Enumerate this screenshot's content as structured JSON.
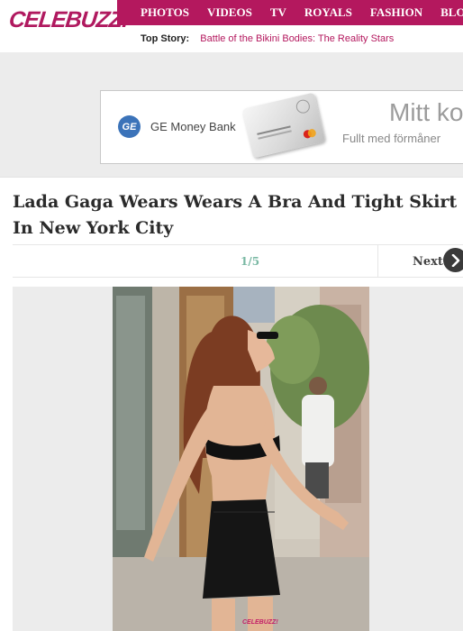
{
  "logo": "CELEBUZZ!",
  "nav": [
    "Photos",
    "Videos",
    "TV",
    "Royals",
    "Fashion",
    "Blogger"
  ],
  "top_story": {
    "label": "Top Story:",
    "link": "Battle of the Bikini Bodies: The Reality Stars"
  },
  "ad": {
    "brand_icon": "GE",
    "bank": "GE Money Bank",
    "headline": "Mitt kort",
    "subline": "Fullt med förmåner"
  },
  "article": {
    "title": "Lada Gaga Wears Wears A Bra And Tight Skirt In New York City",
    "counter": "1/5",
    "next_label": "Next",
    "next_icon": "chevron-right-icon"
  },
  "photo": {
    "watermark": "CELEBUZZ!"
  },
  "colors": {
    "brand": "#b4185e",
    "counter": "#79b8a3"
  }
}
